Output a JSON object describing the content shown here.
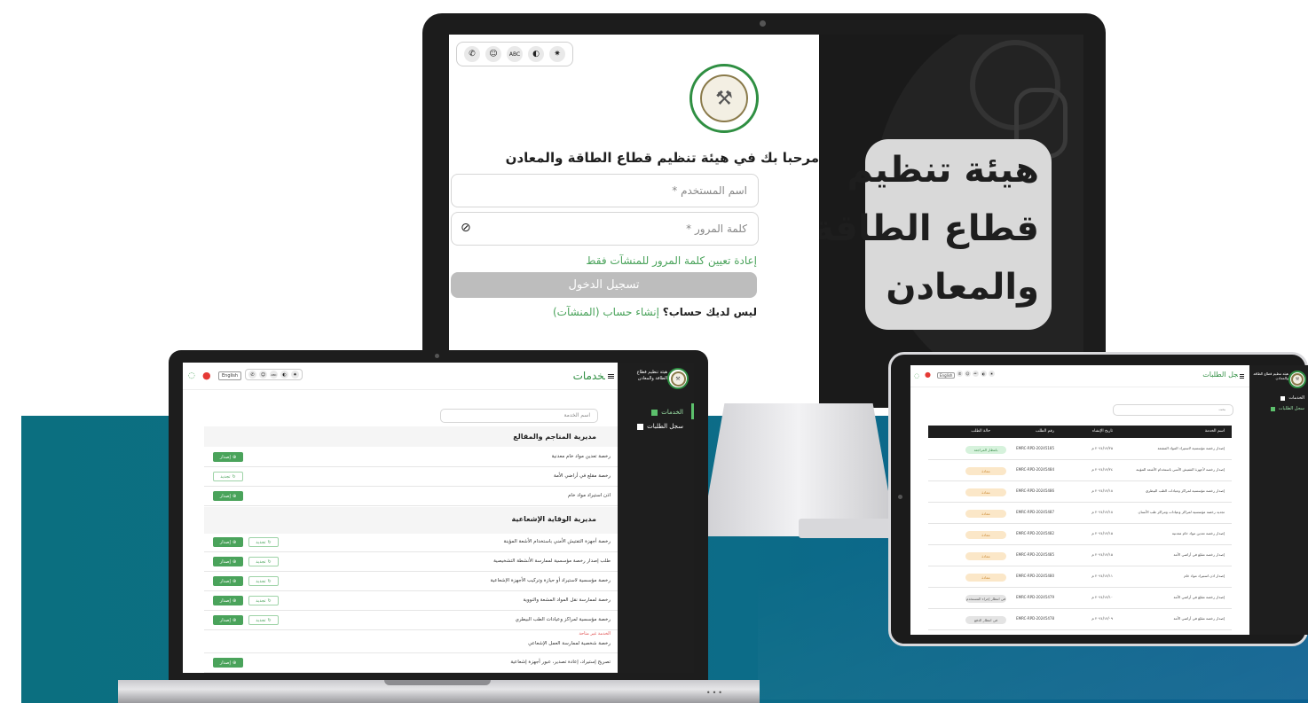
{
  "monitor": {
    "toolbar_icons": [
      "phone-icon",
      "sign-language-icon",
      "abc-icon",
      "contrast-icon",
      "brightness-icon"
    ],
    "welcome": "مرحبا بك في هيئة تنظيم قطاع الطاقة والمعادن",
    "username_placeholder": "اسم المستخدم *",
    "password_placeholder": "كلمة المرور *",
    "reset_link": "إعادة تعيين كلمة المرور للمنشآت فقط",
    "login_button": "تسجيل الدخول",
    "no_account": "ليس لديك حساب؟",
    "create_account": "إنشاء حساب (المنشآت)",
    "hero_lines": [
      "هيئة تنظيم",
      "قطاع الطاقة",
      "والمعادن"
    ]
  },
  "laptop": {
    "lang_button": "English",
    "page_title": "الخدمات",
    "brand": "هيئة تنظيم قطاع الطاقة والمعادن",
    "sidebar": [
      {
        "label": "الخدمات"
      },
      {
        "label": "سجل الطلبات"
      }
    ],
    "search_placeholder": "اسم الخدمة",
    "issue_label": "إصدار",
    "renew_label": "تجديد",
    "section1": "مديرية المناجم والمقالع",
    "section2": "مديرية الوقاية الإشعاعية",
    "rows1": [
      "رخصة تعدين مواد خام معدنية",
      "رخصة مقلع في أراضي الأمة",
      "اذن استيراد مواد خام"
    ],
    "rows2": [
      "رخصة أجهزة التفتيش الأمني باستخدام الأشعة المؤينة",
      "طلب إصدار رخصة مؤسسية لممارسة الأنشطة التشخيصية",
      "رخصة مؤسسية لاستيراد أو حيازة وتركيب الأجهزة الإشعاعية",
      "رخصة لممارسة نقل المواد المشعة والنووية",
      "رخصة مؤسسية لمراكز وعيادات الطب البيطري"
    ],
    "row_note": "الخدمة غير متاحة",
    "row_note_name": "رخصة شخصية لممارسة العمل الإشعاعي",
    "last_row": "تصريح إستيراد، إعادة تصدير، عبور أجهزة إشعاعية"
  },
  "tablet": {
    "lang_button": "English",
    "page_title": "سجل الطلبات",
    "brand": "هيئة تنظيم قطاع الطاقة والمعادن",
    "sidebar": [
      {
        "label": "الخدمات"
      },
      {
        "label": "سجل الطلبات"
      }
    ],
    "search_placeholder": "بحث",
    "headers": [
      "اسم الخدمة",
      "تاريخ الإنشاء",
      "رقم الطلب",
      "حالة الطلب"
    ],
    "rows": [
      {
        "service": "إصدار رخصة مؤسسية لاستيراد المواد المشعة",
        "date": "٢٠٢٤/١٢/٢٥ م",
        "number": "EMRC-RPD-20245185",
        "status": "بانتظار المراجعة",
        "tone": "green"
      },
      {
        "service": "إصدار رخصة لأجهزة التفتيش الأمني باستخدام الأشعة المؤينة",
        "date": "٢٠٢٤/١٢/٢٤ م",
        "number": "EMRC-RPD-20245484",
        "status": "معادة",
        "tone": "orange"
      },
      {
        "service": "إصدار رخصة مؤسسية لمراكز وعيادات الطب البيطري",
        "date": "٢٠٢٤/١٢/١٨ م",
        "number": "EMRC-RPD-20245486",
        "status": "معادة",
        "tone": "orange"
      },
      {
        "service": "تجديد رخصة مؤسسية لمراكز وعيادات ومراكز طب الأسنان",
        "date": "٢٠٢٤/١٢/١٨ م",
        "number": "EMRC-RPD-20245487",
        "status": "معادة",
        "tone": "orange"
      },
      {
        "service": "إصدار رخصة تعدين مواد خام معدنية",
        "date": "٢٠٢٤/١٢/١٥ م",
        "number": "EMRC-RPD-20245482",
        "status": "معادة",
        "tone": "orange"
      },
      {
        "service": "إصدار رخصة مقلع في أراضي الأمة",
        "date": "٢٠٢٤/١٢/١٥ م",
        "number": "EMRC-RPD-20245485",
        "status": "معادة",
        "tone": "orange"
      },
      {
        "service": "إصدار اذن استيراد مواد خام",
        "date": "٢٠٢٤/١٢/١١ م",
        "number": "EMRC-RPD-20245480",
        "status": "معادة",
        "tone": "orange"
      },
      {
        "service": "إصدار رخصة مقلع في أراضي الأمة",
        "date": "٢٠٢٤/١٢/١٠ م",
        "number": "EMRC-RPD-20245479",
        "status": "في انتظار إجراء المستخدم",
        "tone": "gray"
      },
      {
        "service": "إصدار رخصة مقلع في أراضي الأمة",
        "date": "٢٠٢٤/١٢/٠٩ م",
        "number": "EMRC-RPD-20245478",
        "status": "في انتظار الدفع",
        "tone": "gray"
      },
      {
        "service": "إصدار اذن استيراد مواد خام",
        "date": "٢٠٢٤/١٢/٠٥ م",
        "number": "EMRC-RPD-20245465",
        "status": "في انتظار الدفع",
        "tone": "gray"
      },
      {
        "service": "إصدار رخصة مقلع في أراضي الأمة",
        "date": "٢٠٢٤/١٢/٠٢ م",
        "number": "EMRC-RPD-20245464",
        "status": "في انتظار الدفع",
        "tone": "gray"
      }
    ]
  }
}
